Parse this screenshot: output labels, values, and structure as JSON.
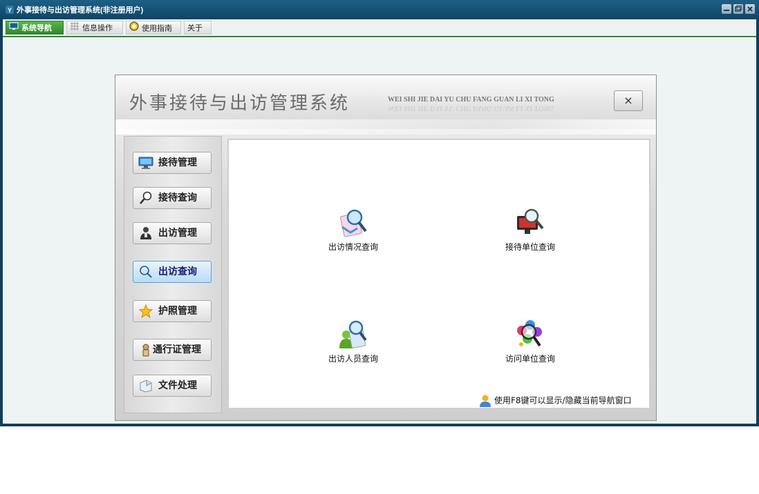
{
  "window": {
    "title": "外事接待与出访管理系统(非注册用户)"
  },
  "tabs": [
    {
      "label": "系统导航",
      "icon": "monitor-icon",
      "active": true
    },
    {
      "label": "信息操作",
      "icon": "grid-icon",
      "active": false
    },
    {
      "label": "使用指南",
      "icon": "clock-icon",
      "active": false
    },
    {
      "label": "关于",
      "icon": "",
      "active": false
    }
  ],
  "dialog": {
    "title": "外事接待与出访管理系统",
    "pinyin": "WEI SHI JIE DAI YU CHU FANG GUAN LI XI TONG",
    "close_label": "×"
  },
  "sidebar": {
    "items": [
      {
        "label": "接待管理",
        "icon": "monitor-icon",
        "active": false
      },
      {
        "label": "接待查询",
        "icon": "magnifier-icon",
        "active": false
      },
      {
        "label": "出访管理",
        "icon": "person-icon",
        "active": false
      },
      {
        "label": "出访查询",
        "icon": "search-icon",
        "active": true
      },
      {
        "label": "护照管理",
        "icon": "star-icon",
        "active": false
      },
      {
        "label": "通行证管理",
        "icon": "badge-icon",
        "active": false
      },
      {
        "label": "文件处理",
        "icon": "document-icon",
        "active": false
      }
    ]
  },
  "main": {
    "items": [
      {
        "label": "出访情况查询",
        "icon": "document-search-icon"
      },
      {
        "label": "接待单位查询",
        "icon": "monitor-search-icon"
      },
      {
        "label": "出访人员查询",
        "icon": "people-search-icon"
      },
      {
        "label": "访问单位查询",
        "icon": "group-search-icon"
      }
    ],
    "tip": "使用F8键可以显示/隐藏当前导航窗口"
  },
  "colors": {
    "titlebar": "#0e4566",
    "tab_active": "#2f8a2a",
    "nav_active": "#b8dcf6"
  }
}
